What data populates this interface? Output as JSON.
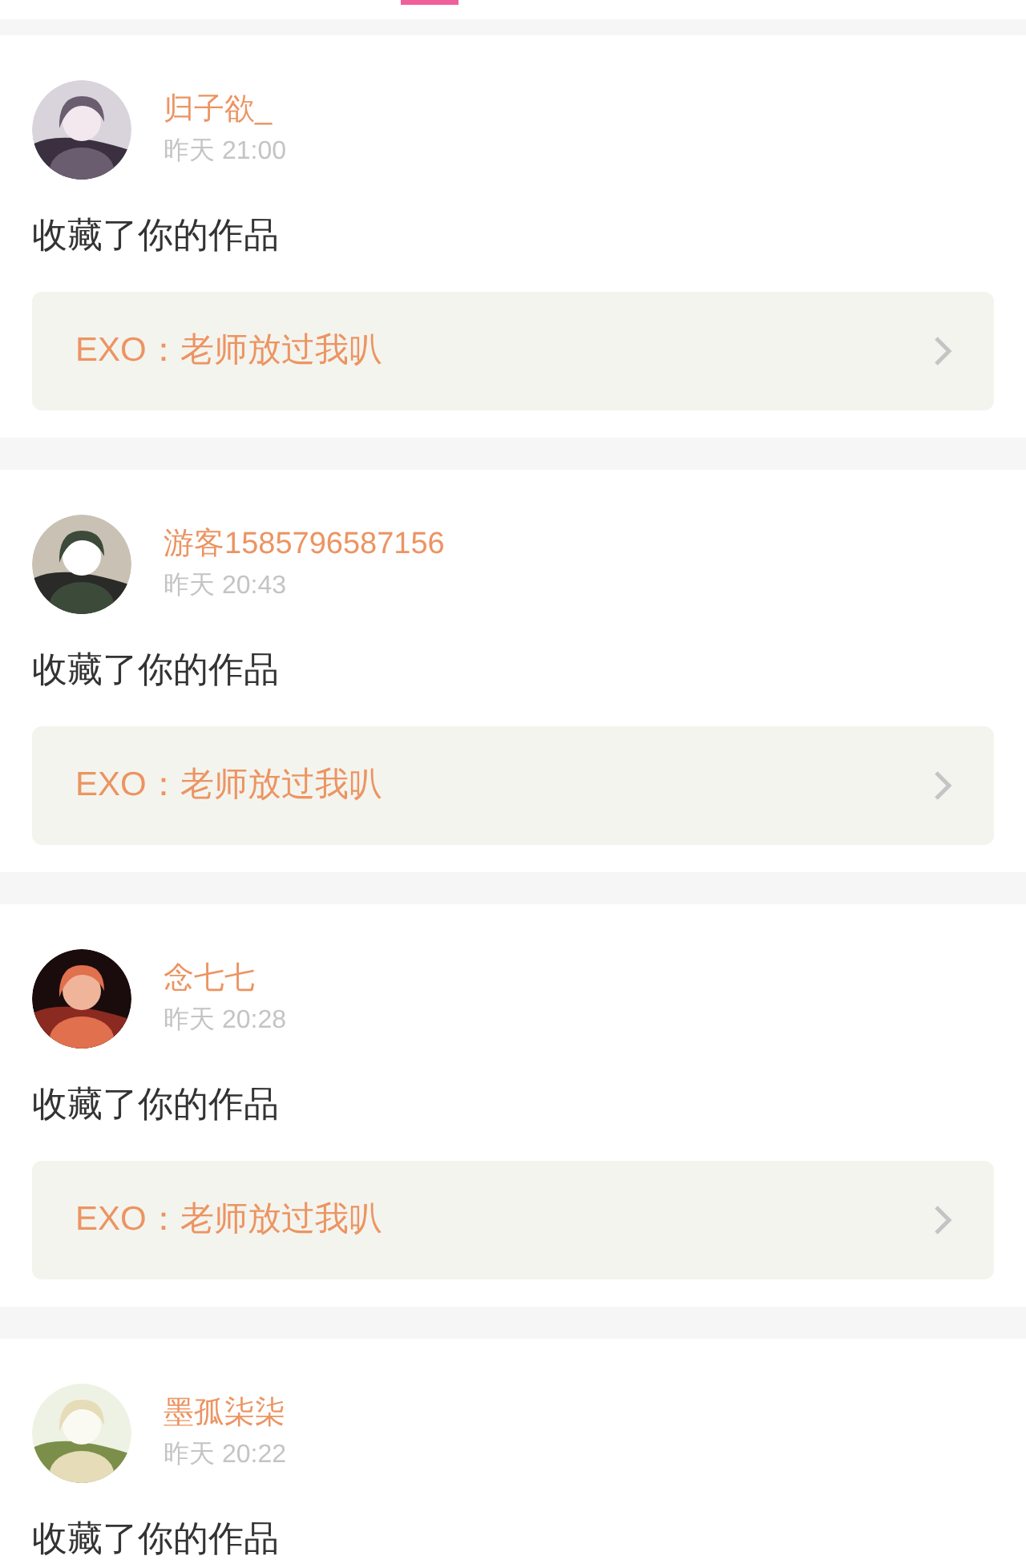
{
  "notifications": [
    {
      "user": "归子欲_",
      "time": "昨天 21:00",
      "message": "收藏了你的作品",
      "work": "EXO：老师放过我叭"
    },
    {
      "user": "游客1585796587156",
      "time": "昨天 20:43",
      "message": "收藏了你的作品",
      "work": "EXO：老师放过我叭"
    },
    {
      "user": "念七七",
      "time": "昨天 20:28",
      "message": "收藏了你的作品",
      "work": "EXO：老师放过我叭"
    },
    {
      "user": "墨孤柒柒",
      "time": "昨天 20:22",
      "message": "收藏了你的作品"
    }
  ]
}
